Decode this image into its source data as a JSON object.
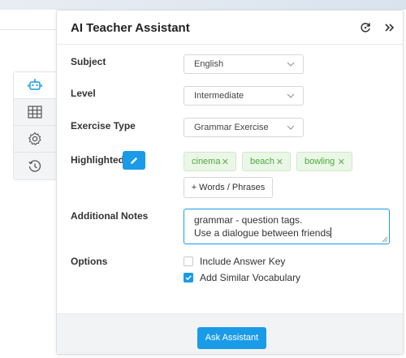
{
  "app": {
    "title": "AI Teacher Assistant"
  },
  "header": {
    "refresh_icon": "refresh-icon",
    "collapse_icon": "double-chevron-right-icon"
  },
  "rail": {
    "items": [
      "robot-icon",
      "table-grid-icon",
      "gear-icon",
      "history-icon"
    ]
  },
  "form": {
    "subject": {
      "label": "Subject",
      "value": "English"
    },
    "level": {
      "label": "Level",
      "value": "Intermediate"
    },
    "exercise_type": {
      "label": "Exercise Type",
      "value": "Grammar Exercise"
    },
    "highlighted": {
      "label": "Highlighted",
      "tags": [
        "cinema",
        "beach",
        "bowling"
      ],
      "add_button": "+ Words / Phrases"
    },
    "notes": {
      "label": "Additional Notes",
      "line1": "grammar - question tags.",
      "line2": "Use a dialogue between friends"
    },
    "options": {
      "label": "Options",
      "include_answer_key": {
        "label": "Include Answer Key",
        "checked": false
      },
      "add_similar_vocab": {
        "label": "Add Similar Vocabulary",
        "checked": true
      }
    }
  },
  "footer": {
    "submit_label": "Ask Assistant"
  },
  "colors": {
    "accent": "#1a9be8",
    "tag_bg": "#eaf7e7",
    "tag_text": "#4caa3a"
  }
}
